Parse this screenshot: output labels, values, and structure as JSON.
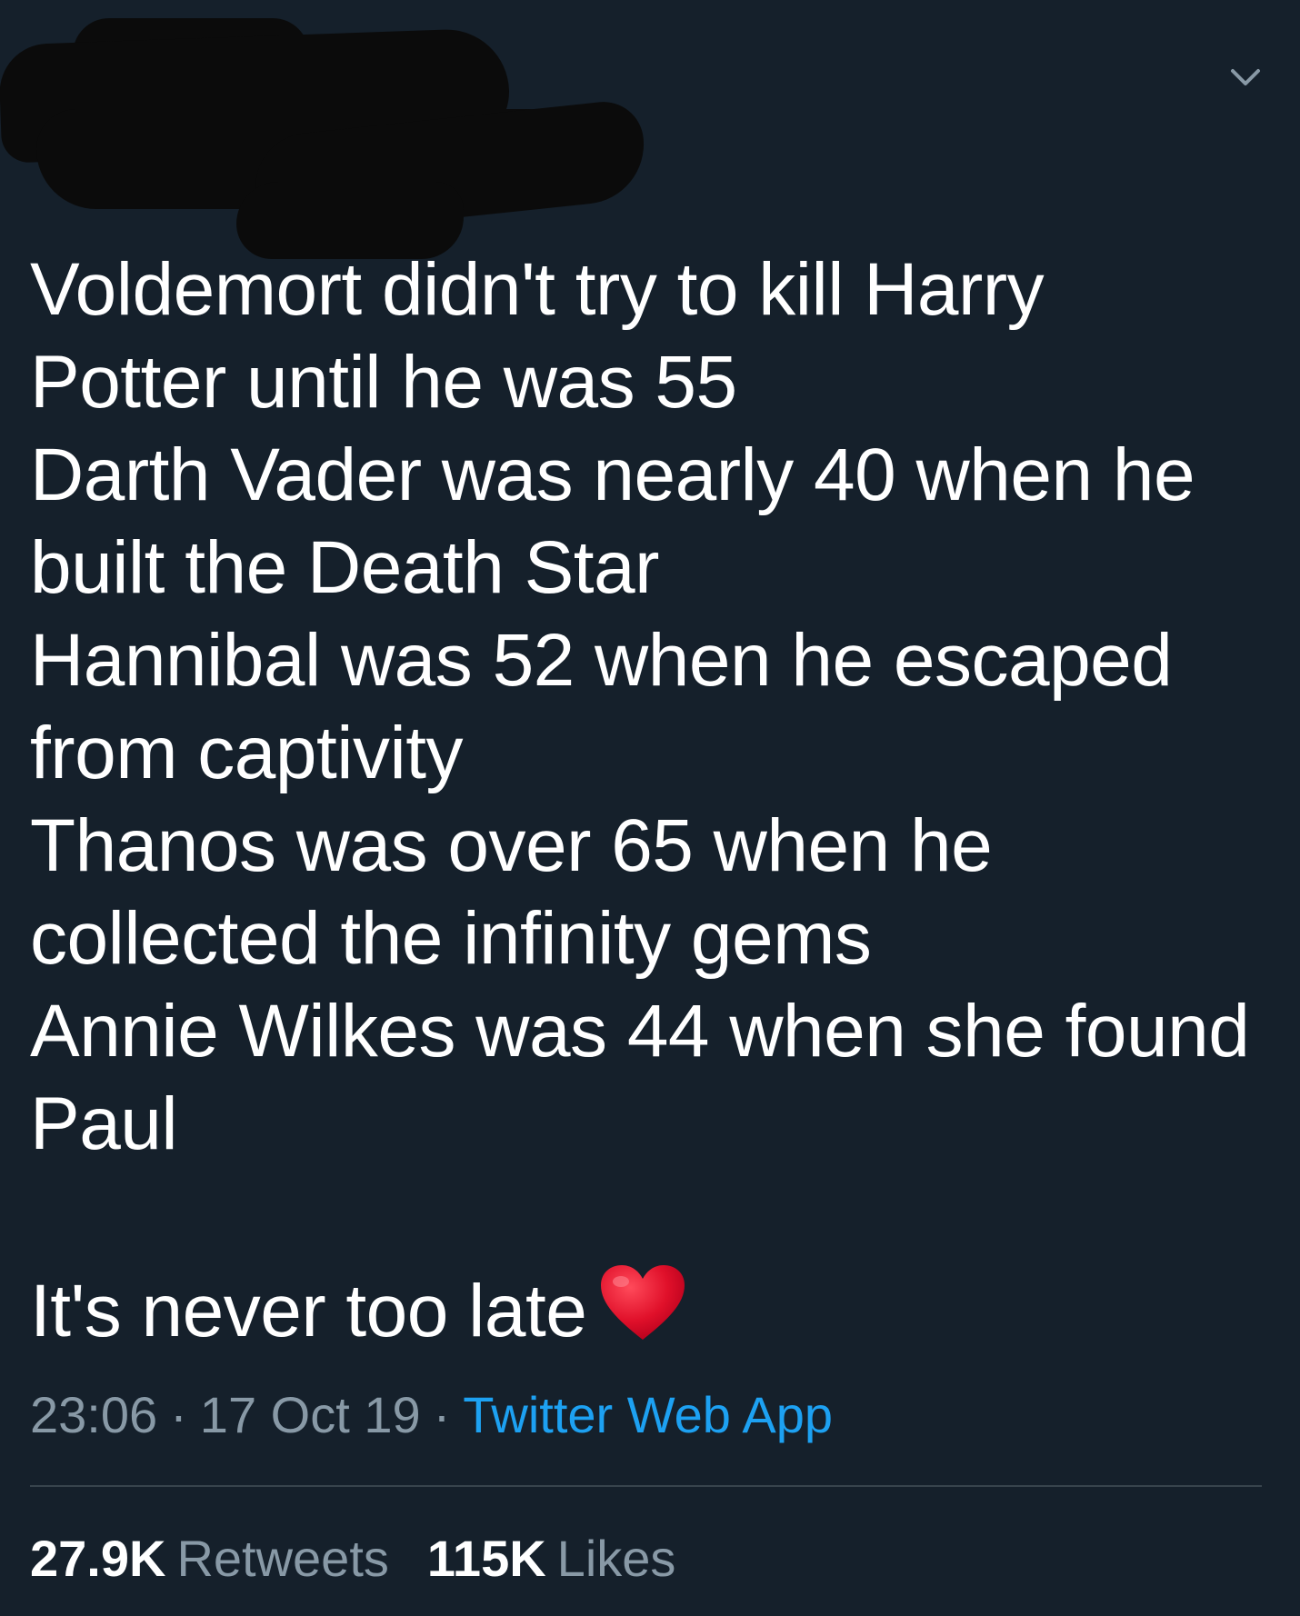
{
  "tweet": {
    "text_lines": [
      "Voldemort didn't try to kill Harry",
      "Potter until he was 55",
      "Darth Vader was nearly 40 when he",
      "built the Death Star",
      "Hannibal was 52 when he escaped",
      "from captivity",
      "Thanos was over 65 when he",
      "collected the infinity gems",
      "Annie Wilkes was 44 when she found",
      "Paul"
    ],
    "closing_line": "It's never too late",
    "emoji": "red-heart",
    "time": "23:06",
    "date": "17 Oct 19",
    "separator": "·",
    "source": "Twitter Web App"
  },
  "stats": {
    "retweets_count": "27.9K",
    "retweets_label": "Retweets",
    "likes_count": "115K",
    "likes_label": "Likes"
  },
  "colors": {
    "background": "#15202b",
    "text": "#ffffff",
    "muted": "#8899a6",
    "link": "#1da1f2",
    "divider": "#38444d",
    "heart": "#e0102a"
  },
  "icons": {
    "menu": "chevron-down-icon",
    "emoji": "heart-icon"
  }
}
